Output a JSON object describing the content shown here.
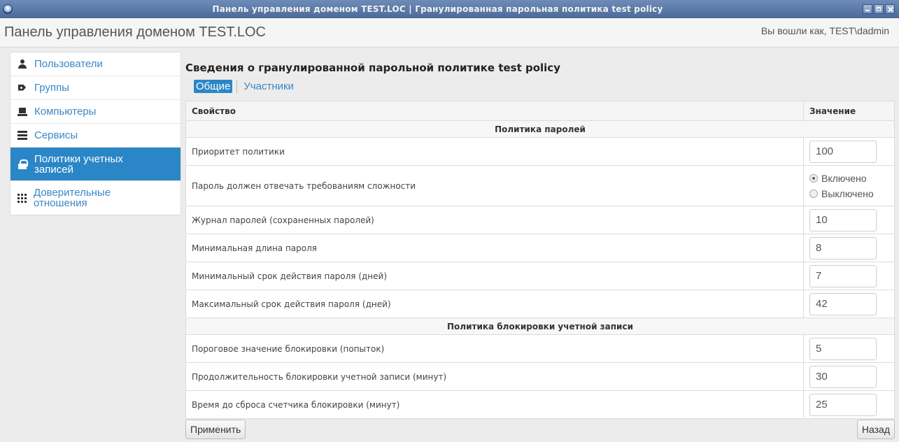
{
  "window": {
    "title": "Панель управления доменом TEST.LOC | Гранулированная парольная политика test policy"
  },
  "header": {
    "brand": "Панель управления доменом TEST.LOC",
    "user": "Вы вошли как, TEST\\dadmin"
  },
  "sidebar": {
    "items": [
      {
        "label": "Пользователи",
        "icon": "user-icon",
        "active": false
      },
      {
        "label": "Группы",
        "icon": "tag-icon",
        "active": false
      },
      {
        "label": "Компьютеры",
        "icon": "computer-icon",
        "active": false
      },
      {
        "label": "Сервисы",
        "icon": "server-icon",
        "active": false
      },
      {
        "label_line1": "Политики учетных",
        "label_line2": "записей",
        "icon": "lock-icon",
        "active": true
      },
      {
        "label_line1": "Доверительные",
        "label_line2": "отношения",
        "icon": "grid-icon",
        "active": false
      }
    ]
  },
  "main": {
    "title": "Сведения о гранулированной парольной политике test policy",
    "tabs": [
      {
        "label": "Общие",
        "active": true
      },
      {
        "label": "Участники",
        "active": false
      }
    ],
    "table": {
      "col_property": "Свойство",
      "col_value": "Значение",
      "section_password": "Политика паролей",
      "section_lockout": "Политика блокировки учетной записи",
      "rows": {
        "priority": {
          "label": "Приоритет политики",
          "value": "100"
        },
        "complexity": {
          "label": "Пароль должен отвечать требованиям сложности",
          "opt_on": "Включено",
          "opt_off": "Выключено",
          "selected": "Включено"
        },
        "history": {
          "label": "Журнал паролей (сохраненных паролей)",
          "value": "10"
        },
        "min_length": {
          "label": "Минимальная длина пароля",
          "value": "8"
        },
        "min_age": {
          "label": "Минимальный срок действия пароля (дней)",
          "value": "7"
        },
        "max_age": {
          "label": "Максимальный срок действия пароля (дней)",
          "value": "42"
        },
        "lockout_threshold": {
          "label": "Пороговое значение блокировки (попыток)",
          "value": "5"
        },
        "lockout_duration": {
          "label": "Продолжительность блокировки учетной записи (минут)",
          "value": "30"
        },
        "lockout_reset": {
          "label": "Время до сброса счетчика блокировки (минут)",
          "value": "25"
        }
      }
    },
    "buttons": {
      "apply": "Применить",
      "back": "Назад"
    }
  }
}
